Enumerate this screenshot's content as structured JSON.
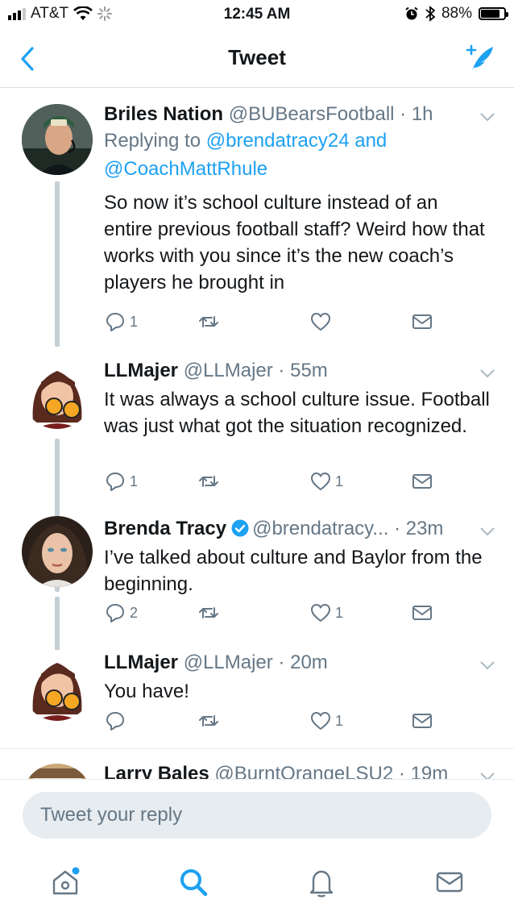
{
  "status_bar": {
    "carrier": "AT&T",
    "time": "12:45 AM",
    "battery_percent": "88%",
    "battery_level": 0.88
  },
  "nav": {
    "title": "Tweet",
    "back_icon": "chevron-left-icon",
    "compose_icon": "compose-tweet-icon"
  },
  "colors": {
    "accent": "#1da1f2",
    "secondary_text": "#657786",
    "thread_line": "#c4cfd6"
  },
  "tweets": [
    {
      "name": "Briles Nation",
      "handle": "@BUBearsFootball",
      "time": "1h",
      "replying_prefix": "Replying to",
      "replying_user1": "@brendatracy24",
      "replying_and": "and",
      "replying_user2": "@CoachMattRhule",
      "text": "So now it’s school culture instead of an entire previous football staff? Weird how that works with you since it’s the new coach’s players he brought in",
      "replies": "1",
      "retweets": "",
      "likes": ""
    },
    {
      "name": "LLMajer",
      "handle": "@LLMajer",
      "time": "55m",
      "text": "It was always a school culture issue. Football was just what got the situation recognized.",
      "replies": "1",
      "retweets": "",
      "likes": "1"
    },
    {
      "name": "Brenda Tracy",
      "handle": "@brendatracy...",
      "time": "23m",
      "verified": true,
      "text": "I’ve talked about culture and Baylor from the beginning.",
      "replies": "2",
      "retweets": "",
      "likes": "1"
    },
    {
      "name": "LLMajer",
      "handle": "@LLMajer",
      "time": "20m",
      "text": "You have!",
      "replies": "",
      "retweets": "",
      "likes": "1"
    },
    {
      "name": "Larry Bales",
      "handle": "@BurntOrangeLSU2",
      "time": "19m"
    }
  ],
  "reply_box": {
    "placeholder": "Tweet your reply"
  },
  "tab_bar": {
    "items": [
      "home-icon",
      "search-icon",
      "notifications-icon",
      "messages-icon"
    ]
  }
}
